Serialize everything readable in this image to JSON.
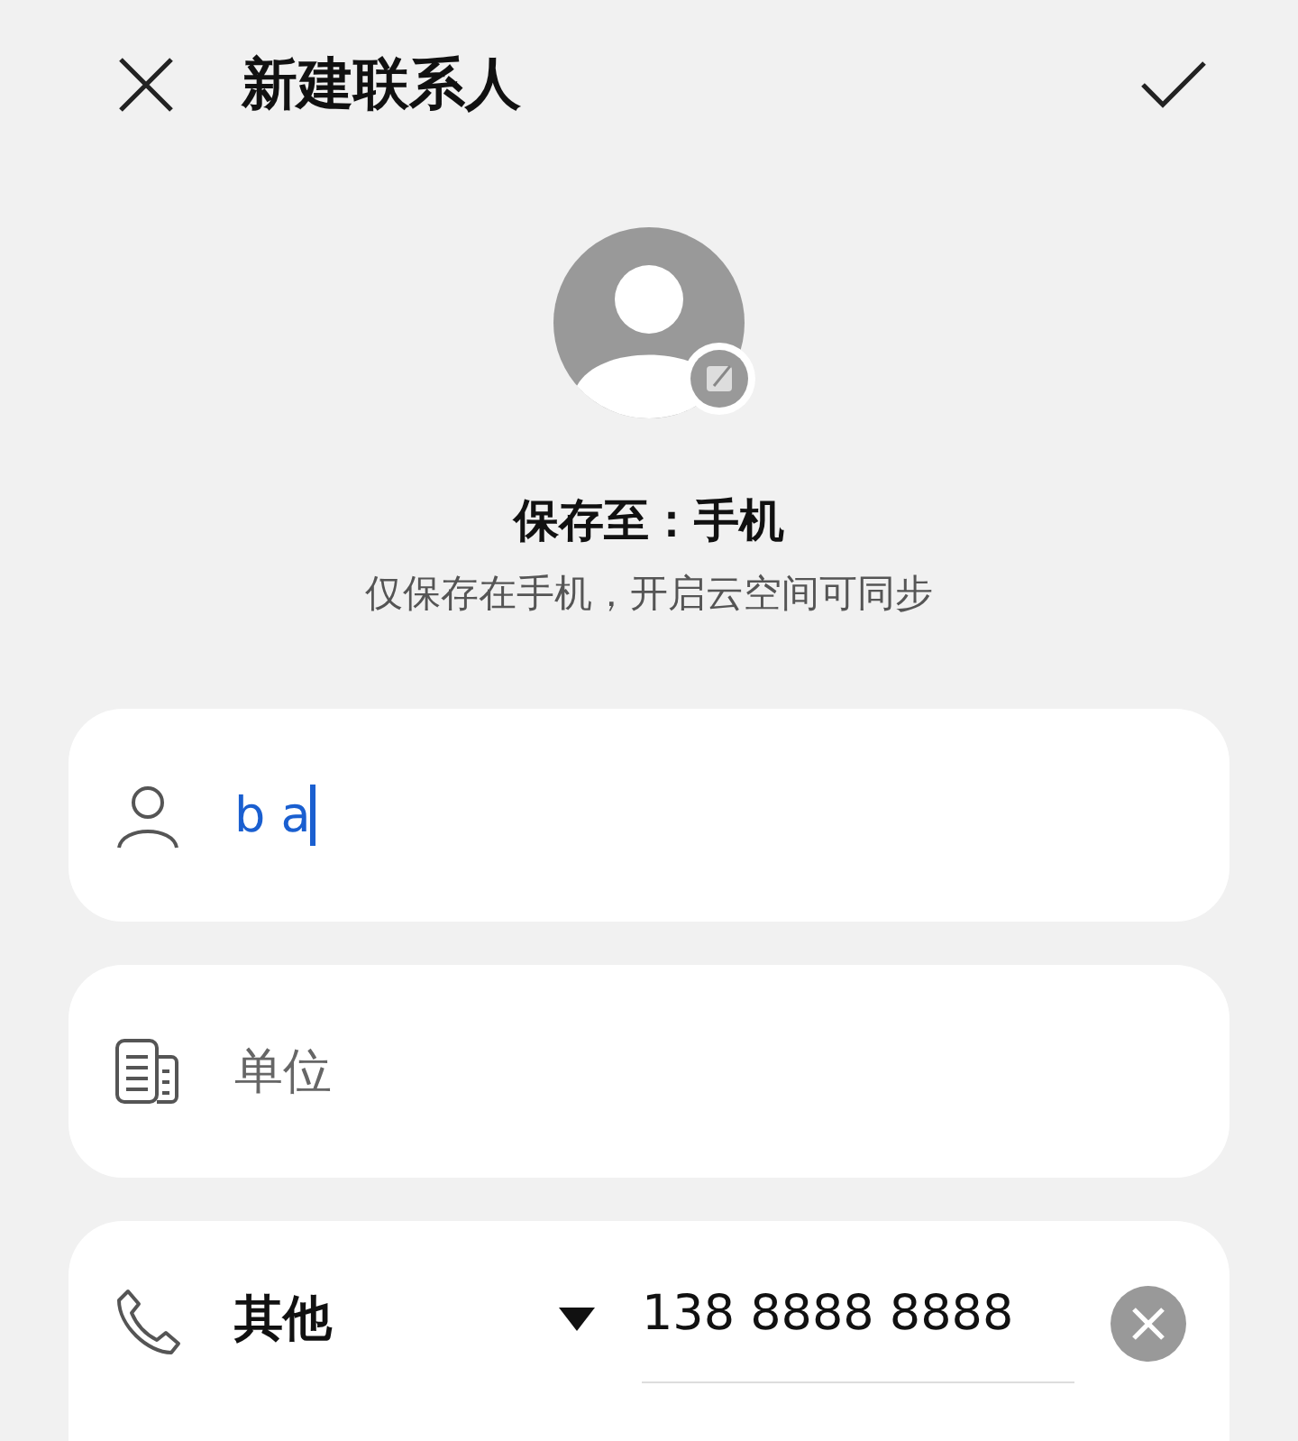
{
  "header": {
    "title": "新建联系人"
  },
  "save_location": {
    "label": "保存至：手机",
    "note": "仅保存在手机，开启云空间可同步"
  },
  "name_field": {
    "value": "b a",
    "focused": true
  },
  "company_field": {
    "placeholder": "单位"
  },
  "phone_field": {
    "type_label": "其他",
    "value": "138 8888 8888"
  }
}
